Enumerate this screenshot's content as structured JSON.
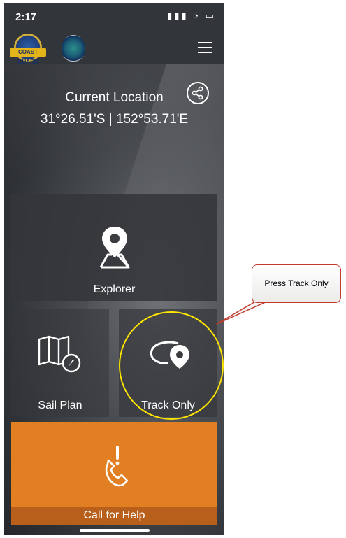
{
  "status_bar": {
    "time": "2:17",
    "signal_icons": "▮▮▮ ◔ ▭"
  },
  "header": {
    "logo_primary_text": "COAST GUARD",
    "menu_icon": "hamburger-menu-icon"
  },
  "location": {
    "title": "Current Location",
    "coordinates": "31°26.51'S | 152°53.71'E"
  },
  "tiles": {
    "explorer": {
      "label": "Explorer",
      "icon": "map-pin-icon"
    },
    "sail_plan": {
      "label": "Sail Plan",
      "icon": "map-compass-icon"
    },
    "track_only": {
      "label": "Track Only",
      "icon": "track-path-icon"
    },
    "help": {
      "label": "Call for Help",
      "icon": "phone-alert-icon"
    }
  },
  "annotation": {
    "callout_text": "Press Track Only"
  },
  "colors": {
    "help_orange": "#e27f22",
    "help_label_bar": "#b8601b",
    "highlight_ring": "#ffe600",
    "callout_border": "#c0392b"
  }
}
